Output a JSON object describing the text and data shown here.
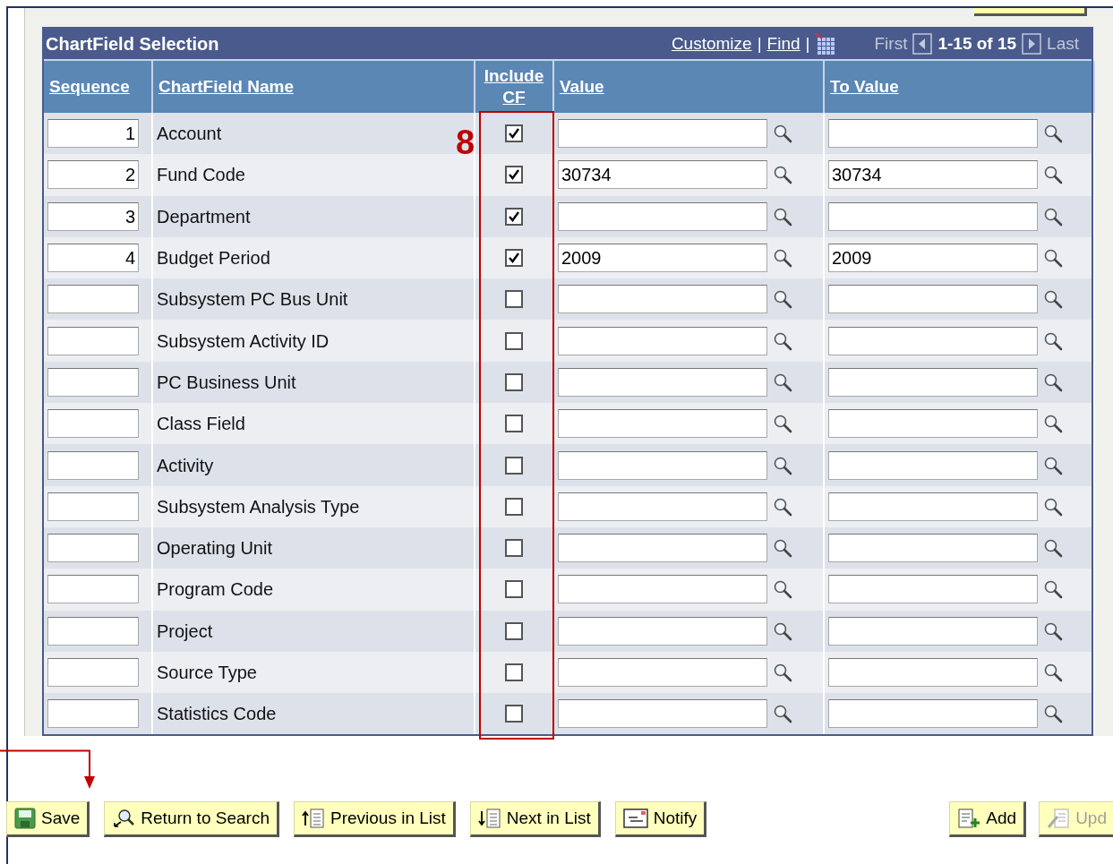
{
  "grid": {
    "title": "ChartField Selection",
    "links": [
      {
        "label": "Customize"
      },
      {
        "label": "Find"
      }
    ],
    "separators": [
      "|",
      "|"
    ],
    "pager": {
      "first": {
        "label": "First",
        "disabled": true
      },
      "range": "1-15 of 15",
      "last": {
        "label": "Last",
        "disabled": true
      }
    },
    "columns": [
      "Sequence",
      "ChartField Name",
      "Include CF",
      "Value",
      "To Value"
    ],
    "rows": [
      {
        "sequence": "1",
        "name": "Account",
        "include_cf": true
      },
      {
        "sequence": "2",
        "name": "Fund Code",
        "include_cf": true,
        "value": "30734",
        "to_value": "30734"
      },
      {
        "sequence": "3",
        "name": "Department",
        "include_cf": true
      },
      {
        "sequence": "4",
        "name": "Budget Period",
        "include_cf": true,
        "value": "2009",
        "to_value": "2009"
      },
      {
        "name": "Subsystem PC Bus Unit",
        "include_cf": false
      },
      {
        "name": "Subsystem Activity ID",
        "include_cf": false
      },
      {
        "name": "PC Business Unit",
        "include_cf": false
      },
      {
        "name": "Class Field",
        "include_cf": false
      },
      {
        "name": "Activity",
        "include_cf": false
      },
      {
        "name": "Subsystem Analysis Type",
        "include_cf": false
      },
      {
        "name": "Operating Unit",
        "include_cf": false
      },
      {
        "name": "Program Code",
        "include_cf": false
      },
      {
        "name": "Project",
        "include_cf": false
      },
      {
        "name": "Source Type",
        "include_cf": false
      },
      {
        "name": "Statistics Code",
        "include_cf": false
      }
    ]
  },
  "annotation": {
    "label": "8"
  },
  "buttons_left": [
    {
      "label": "Save",
      "kind": "save",
      "disabled": false
    },
    {
      "label": "Return to Search",
      "kind": "search",
      "disabled": false
    },
    {
      "label": "Previous in List",
      "kind": "previous",
      "disabled": false
    },
    {
      "label": "Next in List",
      "kind": "next",
      "disabled": false
    },
    {
      "label": "Notify",
      "kind": "notify",
      "disabled": false
    }
  ],
  "buttons_right": [
    {
      "label": "Add",
      "kind": "add",
      "disabled": false
    },
    {
      "label": "Upd",
      "kind": "update",
      "disabled": true
    }
  ]
}
